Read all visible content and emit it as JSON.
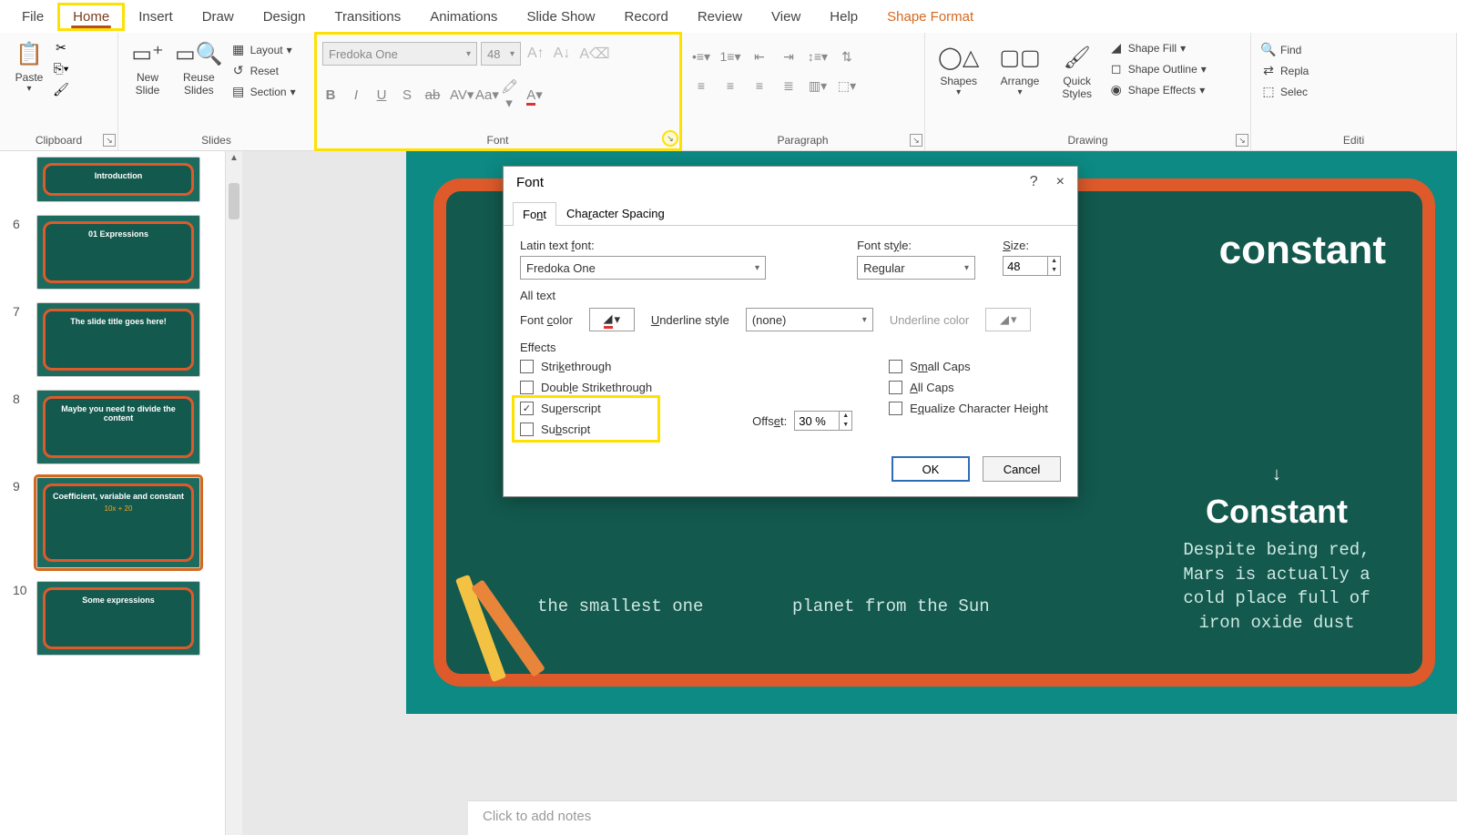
{
  "tabs": {
    "file": "File",
    "home": "Home",
    "insert": "Insert",
    "draw": "Draw",
    "design": "Design",
    "transitions": "Transitions",
    "animations": "Animations",
    "slideshow": "Slide Show",
    "record": "Record",
    "review": "Review",
    "view": "View",
    "help": "Help",
    "shapefmt": "Shape Format"
  },
  "ribbon": {
    "clipboard": {
      "label": "Clipboard",
      "paste": "Paste"
    },
    "slides": {
      "label": "Slides",
      "newslide": "New\nSlide",
      "reuse": "Reuse\nSlides",
      "layout": "Layout",
      "reset": "Reset",
      "section": "Section"
    },
    "font": {
      "label": "Font",
      "name": "Fredoka One",
      "size": "48"
    },
    "paragraph": {
      "label": "Paragraph"
    },
    "drawing": {
      "label": "Drawing",
      "shapes": "Shapes",
      "arrange": "Arrange",
      "quick": "Quick\nStyles",
      "fill": "Shape Fill",
      "outline": "Shape Outline",
      "effects": "Shape Effects"
    },
    "editing": {
      "label": "Editi",
      "find": "Find",
      "replace": "Repla",
      "select": "Selec"
    }
  },
  "thumbs": [
    {
      "num": "",
      "title": "Introduction"
    },
    {
      "num": "6",
      "title": "01 Expressions"
    },
    {
      "num": "7",
      "title": "The slide title goes here!"
    },
    {
      "num": "8",
      "title": "Maybe you need to divide the content"
    },
    {
      "num": "9",
      "title": "Coefficient, variable and constant",
      "sel": true
    },
    {
      "num": "10",
      "title": "Some expressions"
    }
  ],
  "slide": {
    "word": "constant",
    "col3title": "Constant",
    "col1": "the smallest one",
    "col2": "planet from the Sun",
    "col3": "Despite being red, Mars is actually a cold place full of iron oxide dust"
  },
  "notes_placeholder": "Click to add notes",
  "dialog": {
    "title": "Font",
    "help": "?",
    "close": "×",
    "tab_font": "Font",
    "tab_spacing": "Character Spacing",
    "latin_label": "Latin text font:",
    "latin_value": "Fredoka One",
    "style_label": "Font style:",
    "style_value": "Regular",
    "size_label": "Size:",
    "size_value": "48",
    "alltext": "All text",
    "fontcolor": "Font color",
    "ulstyle": "Underline style",
    "ulstyle_value": "(none)",
    "ulcolor": "Underline color",
    "effects": "Effects",
    "strike": "Strikethrough",
    "dstrike": "Double Strikethrough",
    "superscript": "Superscript",
    "subscript": "Subscript",
    "offset": "Offset:",
    "offset_value": "30 %",
    "smallcaps": "Small Caps",
    "allcaps": "All Caps",
    "eqheight": "Equalize Character Height",
    "ok": "OK",
    "cancel": "Cancel"
  }
}
